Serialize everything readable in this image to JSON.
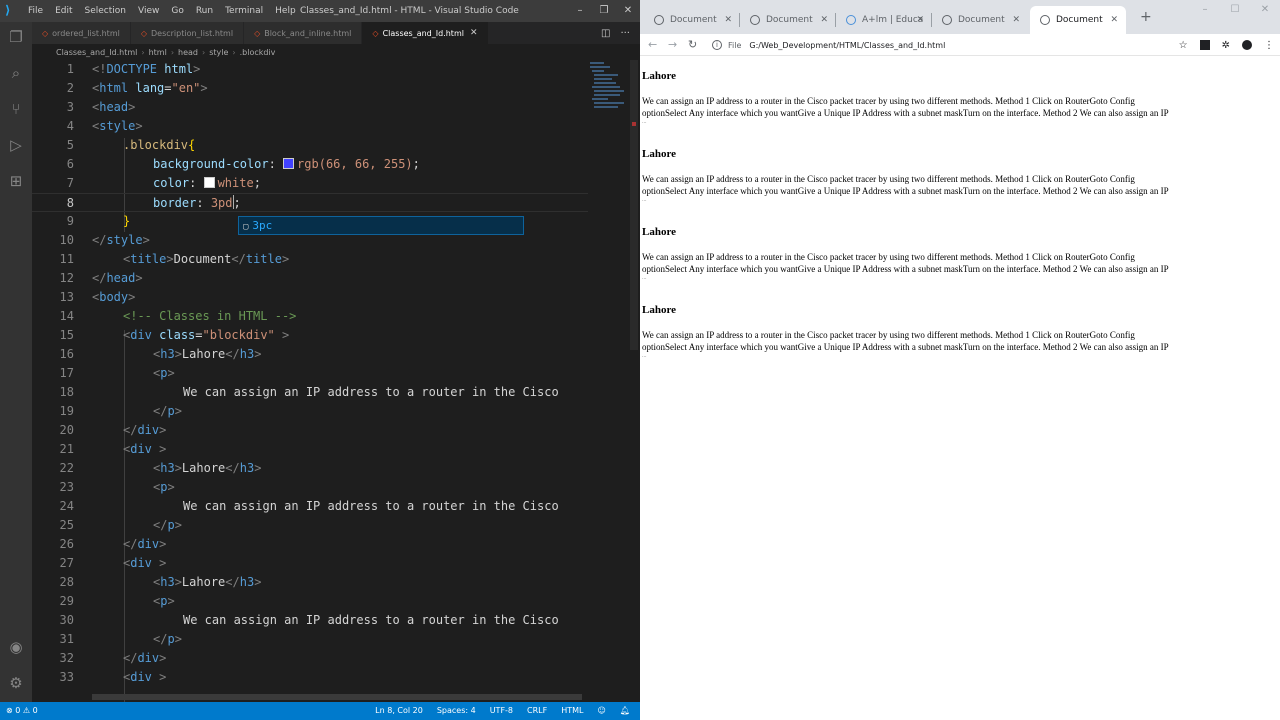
{
  "vscode": {
    "menu": [
      "File",
      "Edit",
      "Selection",
      "View",
      "Go",
      "Run",
      "Terminal",
      "Help"
    ],
    "window_title": "Classes_and_Id.html - HTML - Visual Studio Code",
    "tabs": [
      {
        "label": "ordered_list.html",
        "active": false
      },
      {
        "label": "Description_list.html",
        "active": false
      },
      {
        "label": "Block_and_inline.html",
        "active": false
      },
      {
        "label": "Classes_and_Id.html",
        "active": true
      }
    ],
    "breadcrumb": [
      "Classes_and_Id.html",
      "html",
      "head",
      "style",
      ".blockdiv"
    ],
    "line_numbers": [
      "1",
      "2",
      "3",
      "4",
      "5",
      "6",
      "7",
      "8",
      "9",
      "10",
      "11",
      "12",
      "13",
      "14",
      "15",
      "16",
      "17",
      "18",
      "19",
      "20",
      "21",
      "22",
      "23",
      "24",
      "25",
      "26",
      "27",
      "28",
      "29",
      "30",
      "31",
      "32",
      "33"
    ],
    "code": {
      "l1a": "<!",
      "l1b": "DOCTYPE",
      "l1c": " html",
      "l1d": ">",
      "html_open": "html",
      "lang_attr": " lang",
      "lang_eq": "=",
      "lang_val": "\"en\"",
      "head_open": "head",
      "style_open": "style",
      "selector": ".blockdiv",
      "brace_open": "{",
      "bg_prop": "background-color",
      "bg_val": "rgb(66, 66, 255)",
      "color_prop": "color",
      "color_val": "white",
      "border_prop": "border",
      "border_val": "3pd",
      "brace_close": "}",
      "style_close": "style",
      "title_tag": "title",
      "title_text": "Document",
      "head_close": "head",
      "body_open": "body",
      "comment": "<!-- Classes in HTML -->",
      "div_tag": "div",
      "class_attr": " class",
      "class_val": "\"blockdiv\"",
      "h3_tag": "h3",
      "h3_text": "Lahore",
      "p_tag": "p",
      "para_text": "We can assign an IP address to a router in the Cisco"
    },
    "suggestion": "3pc",
    "status": {
      "left": "⊗ 0  ⚠ 0",
      "position": "Ln 8, Col 20",
      "spaces": "Spaces: 4",
      "encoding": "UTF-8",
      "eol": "CRLF",
      "language": "HTML"
    },
    "colors": {
      "swatch_blue": "#4242ff",
      "swatch_white": "#ffffff",
      "accent": "#007acc"
    }
  },
  "chrome": {
    "tabs": [
      {
        "label": "Document",
        "active": false
      },
      {
        "label": "Document",
        "active": false
      },
      {
        "label": "A+lm | Educa",
        "active": false
      },
      {
        "label": "Document",
        "active": false
      },
      {
        "label": "Document",
        "active": true
      }
    ],
    "address": {
      "scheme_label": "File",
      "url": "G:/Web_Development/HTML/Classes_and_Id.html"
    },
    "page": {
      "blocks": [
        {
          "heading": "Lahore",
          "line1": "We can assign an IP address to a router in the Cisco packet tracer by using two different methods. Method 1 Click on RouterGoto Config",
          "line2": "optionSelect Any interface which you wantGive a Unique IP Address with a subnet maskTurn on the interface. Method 2 We can also assign an IP",
          "line3": "..."
        },
        {
          "heading": "Lahore",
          "line1": "We can assign an IP address to a router in the Cisco packet tracer by using two different methods. Method 1 Click on RouterGoto Config",
          "line2": "optionSelect Any interface which you wantGive a Unique IP Address with a subnet maskTurn on the interface. Method 2 We can also assign an IP",
          "line3": "..."
        },
        {
          "heading": "Lahore",
          "line1": "We can assign an IP address to a router in the Cisco packet tracer by using two different methods. Method 1 Click on RouterGoto Config",
          "line2": "optionSelect Any interface which you wantGive a Unique IP Address with a subnet maskTurn on the interface. Method 2 We can also assign an IP",
          "line3": "..."
        },
        {
          "heading": "Lahore",
          "line1": "We can assign an IP address to a router in the Cisco packet tracer by using two different methods. Method 1 Click on RouterGoto Config",
          "line2": "optionSelect Any interface which you wantGive a Unique IP Address with a subnet maskTurn on the interface. Method 2 We can also assign an IP",
          "line3": "..."
        }
      ]
    }
  }
}
